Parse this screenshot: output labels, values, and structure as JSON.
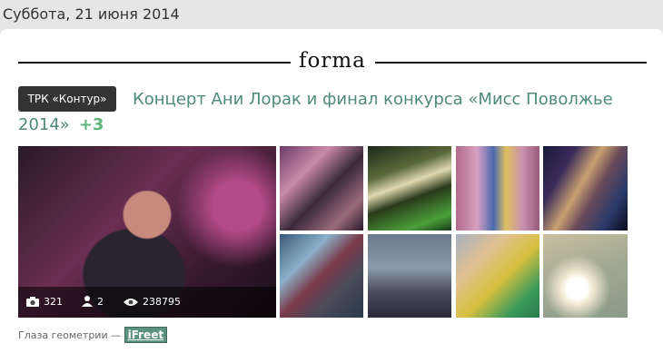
{
  "date": "Суббота, 21 июня 2014",
  "logo": "forma",
  "badge": "ТРК «Контур»",
  "headline": "Концерт Ани Лорак и финал конкурса «Мисс Поволжье 2014»",
  "more_count": "+3",
  "stats": {
    "photos": "321",
    "people": "2",
    "views": "238795"
  },
  "thumbnails": [
    {
      "alt": "photo-2"
    },
    {
      "alt": "photo-3"
    },
    {
      "alt": "photo-4"
    },
    {
      "alt": "photo-5"
    },
    {
      "alt": "photo-6"
    },
    {
      "alt": "photo-7"
    },
    {
      "alt": "photo-8"
    },
    {
      "alt": "photo-9"
    }
  ],
  "caption": {
    "text": "Глаза геометрии —",
    "link": "iFreet"
  }
}
